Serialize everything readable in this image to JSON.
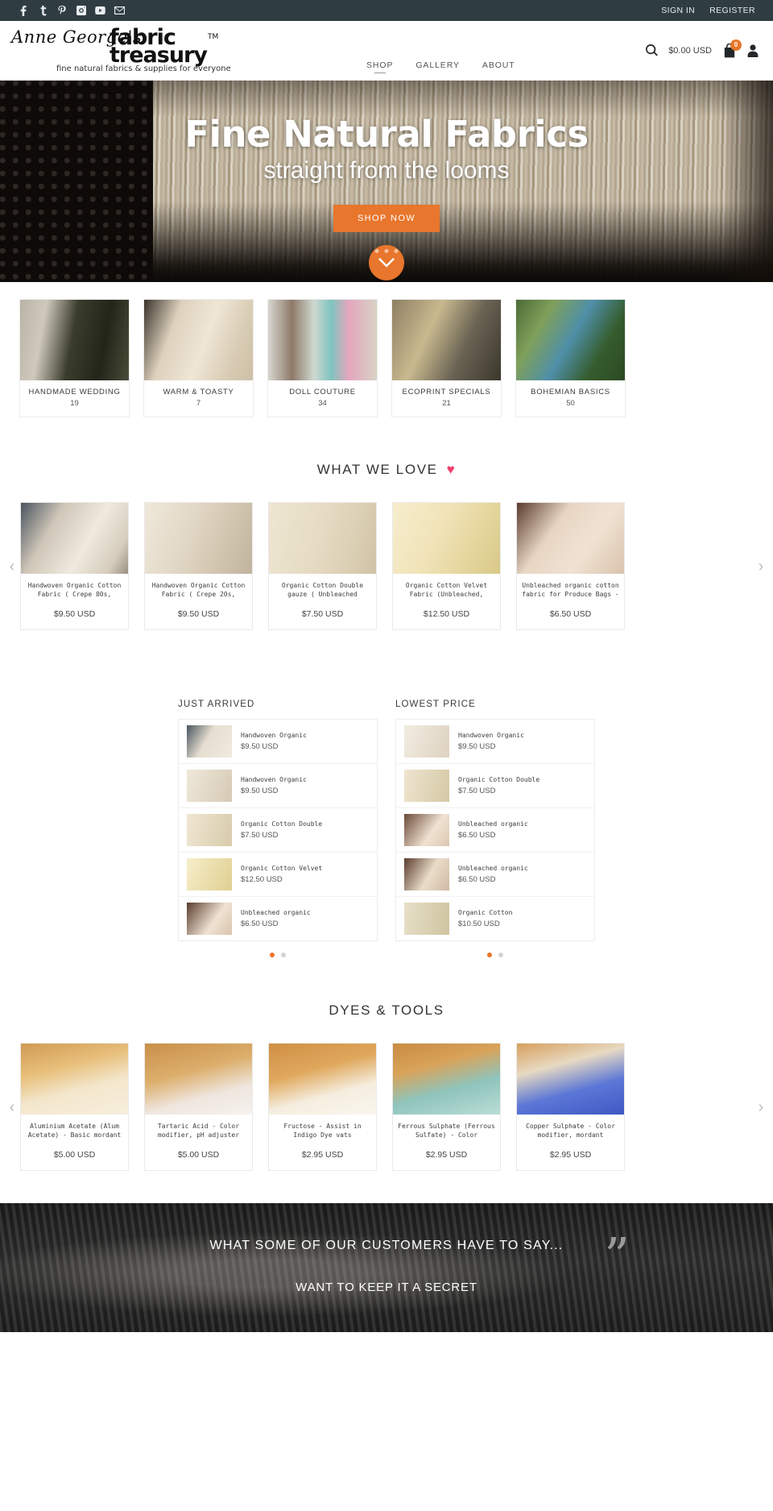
{
  "topbar": {
    "social": [
      {
        "name": "facebook-icon",
        "label": "f"
      },
      {
        "name": "twitter-icon",
        "label": "t"
      },
      {
        "name": "pinterest-icon",
        "label": "p"
      },
      {
        "name": "instagram-icon",
        "label": "ig"
      },
      {
        "name": "youtube-icon",
        "label": "yt"
      },
      {
        "name": "email-icon",
        "label": "mail"
      }
    ],
    "sign_in": "SIGN IN",
    "register": "REGISTER"
  },
  "header": {
    "logo_script": "Anne George's",
    "logo_bold_line1": "fabric",
    "logo_bold_line2": "treasury",
    "logo_tm": "TM",
    "logo_tagline": "fine natural fabrics & supplies for everyone",
    "nav": [
      {
        "label": "SHOP",
        "active": true
      },
      {
        "label": "GALLERY",
        "active": false
      },
      {
        "label": "ABOUT",
        "active": false
      }
    ],
    "cart_total": "$0.00 USD",
    "cart_count": "0"
  },
  "hero": {
    "title": "Fine Natural Fabrics",
    "subtitle": "straight from the looms",
    "cta": "SHOP NOW",
    "dots": 3
  },
  "categories": {
    "items": [
      {
        "name": "HANDMADE WEDDING",
        "count": "19"
      },
      {
        "name": "WARM & TOASTY",
        "count": "7"
      },
      {
        "name": "DOLL COUTURE",
        "count": "34"
      },
      {
        "name": "ECOPRINT SPECIALS",
        "count": "21"
      },
      {
        "name": "BOHEMIAN BASICS",
        "count": "50"
      }
    ]
  },
  "what_we_love": {
    "title": "WHAT WE LOVE",
    "heart": "♥",
    "prev": "‹",
    "next": "›",
    "products": [
      {
        "name": "Handwoven Organic Cotton Fabric ( Crepe 80s,",
        "price": "$9.50 USD"
      },
      {
        "name": "Handwoven Organic Cotton Fabric ( Crepe 20s,",
        "price": "$9.50 USD"
      },
      {
        "name": "Organic Cotton Double gauze ( Unbleached",
        "price": "$7.50 USD"
      },
      {
        "name": "Organic Cotton Velvet Fabric (Unbleached,",
        "price": "$12.50 USD"
      },
      {
        "name": "Unbleached organic cotton fabric for Produce Bags -",
        "price": "$6.50 USD"
      }
    ]
  },
  "just_arrived": {
    "title": "JUST ARRIVED",
    "items": [
      {
        "name": "Handwoven Organic",
        "price": "$9.50 USD"
      },
      {
        "name": "Handwoven Organic",
        "price": "$9.50 USD"
      },
      {
        "name": "Organic Cotton Double",
        "price": "$7.50 USD"
      },
      {
        "name": "Organic Cotton Velvet",
        "price": "$12.50 USD"
      },
      {
        "name": "Unbleached organic",
        "price": "$6.50 USD"
      }
    ]
  },
  "lowest_price": {
    "title": "LOWEST PRICE",
    "items": [
      {
        "name": "Handwoven Organic",
        "price": "$9.50 USD"
      },
      {
        "name": "Organic Cotton Double",
        "price": "$7.50 USD"
      },
      {
        "name": "Unbleached organic",
        "price": "$6.50 USD"
      },
      {
        "name": "Unbleached organic",
        "price": "$6.50 USD"
      },
      {
        "name": "Organic Cotton",
        "price": "$10.50 USD"
      }
    ]
  },
  "dyes_tools": {
    "title": "DYES & TOOLS",
    "prev": "‹",
    "next": "›",
    "products": [
      {
        "name": "Aluminium Acetate (Alum Acetate) - Basic mordant",
        "price": "$5.00 USD"
      },
      {
        "name": "Tartaric Acid - Color modifier, pH adjuster",
        "price": "$5.00 USD"
      },
      {
        "name": "Fructose - Assist in Indigo Dye vats",
        "price": "$2.95 USD"
      },
      {
        "name": "Ferrous Sulphate (Ferrous Sulfate) - Color",
        "price": "$2.95 USD"
      },
      {
        "name": "Copper Sulphate - Color modifier, mordant",
        "price": "$2.95 USD"
      }
    ]
  },
  "testimonials": {
    "heading": "WHAT SOME OF OUR CUSTOMERS HAVE TO SAY...",
    "quote": "WANT TO KEEP IT A SECRET",
    "quote_mark": "”"
  },
  "colors": {
    "accent": "#e8762c",
    "topbar": "#2f3c42",
    "heart": "#ef3d6e"
  }
}
